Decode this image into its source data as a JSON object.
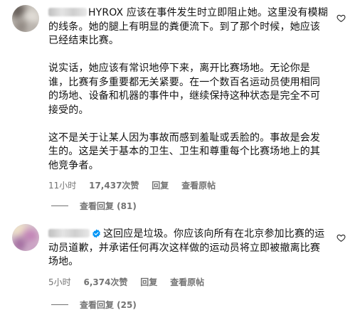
{
  "comments": [
    {
      "username_prefix": "HYROX",
      "paragraphs": [
        "应该在事件发生时立即阻止她。这里没有模糊的线条。她的腿上有明显的粪便流下。到了那个时候，她应该已经结束比赛。",
        "说实话，她应该有常识地停下来，离开比赛场地。无论你是谁，比赛有多重要都无关紧要。在一个数百名运动员使用相同的场地、设备和机器的事件中，继续保持这种状态是完全不可接受的。",
        "这不是关于让某人因为事故而感到羞耻或丢脸的。事故是会发生的。这是关于基本的卫生、卫生和尊重每个比赛场地上的其他竞争者。"
      ],
      "time": "11小时",
      "likes": "17,437次赞",
      "reply": "回复",
      "translation": "查看原帖",
      "view_replies": "查看回复 (81)"
    },
    {
      "text": "这回应是垃圾。你应该向所有在北京参加比赛的运动员道歉，并承诺任何再次这样做的运动员将立即被撤离比赛场地。",
      "time": "5小时",
      "likes": "6,374次赞",
      "reply": "回复",
      "translation": "查看原帖",
      "view_replies": "查看回复 (25)"
    }
  ],
  "icons": {
    "like": "heart-outline-icon",
    "verified": "verified-badge-icon"
  },
  "colors": {
    "text": "#111111",
    "meta": "#737373",
    "verified": "#0095f6"
  }
}
